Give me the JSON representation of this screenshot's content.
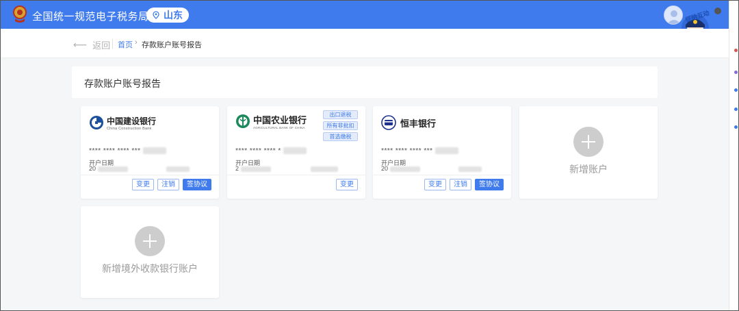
{
  "header": {
    "app_title": "全国统一规范电子税务局",
    "region": "山东",
    "mascot_text": "征纳互动",
    "brand_color": "#3f7bec"
  },
  "breadcrumb": {
    "back_label": "返回",
    "home_label": "首页",
    "separator": "›",
    "current_label": "存款账户账号报告"
  },
  "section": {
    "title": "存款账户账号报告"
  },
  "cards": [
    {
      "bank_name": "中国建设银行",
      "bank_sub": "China Construction Bank",
      "logo_icon": "ccb-logo-icon",
      "account_masked": "**** **** **** ***",
      "open_label": "开户日期",
      "open_date_prefix": "20",
      "buttons": [
        {
          "label": "变更",
          "primary": false
        },
        {
          "label": "注销",
          "primary": false
        },
        {
          "label": "签协议",
          "primary": true
        }
      ]
    },
    {
      "bank_name": "中国农业银行",
      "bank_sub": "AGRICULTURAL BANK OF CHINA",
      "logo_icon": "abc-logo-icon",
      "account_masked": "**** **** **** *",
      "open_label": "开户日期",
      "open_date_prefix": "2",
      "tags": [
        "出口退税",
        "所有非批扣",
        "首选缴税"
      ],
      "buttons": [
        {
          "label": "变更",
          "primary": false
        }
      ]
    },
    {
      "bank_name": "恒丰银行",
      "bank_sub": "",
      "logo_icon": "hengfeng-logo-icon",
      "account_masked": "**** **** **** ***",
      "open_label": "开户日期",
      "open_date_prefix": "20",
      "buttons": [
        {
          "label": "变更",
          "primary": false
        },
        {
          "label": "注销",
          "primary": false
        },
        {
          "label": "签协议",
          "primary": true
        }
      ]
    }
  ],
  "add_cards": {
    "add_account": "新增账户",
    "add_foreign": "新增境外收款银行账户"
  }
}
